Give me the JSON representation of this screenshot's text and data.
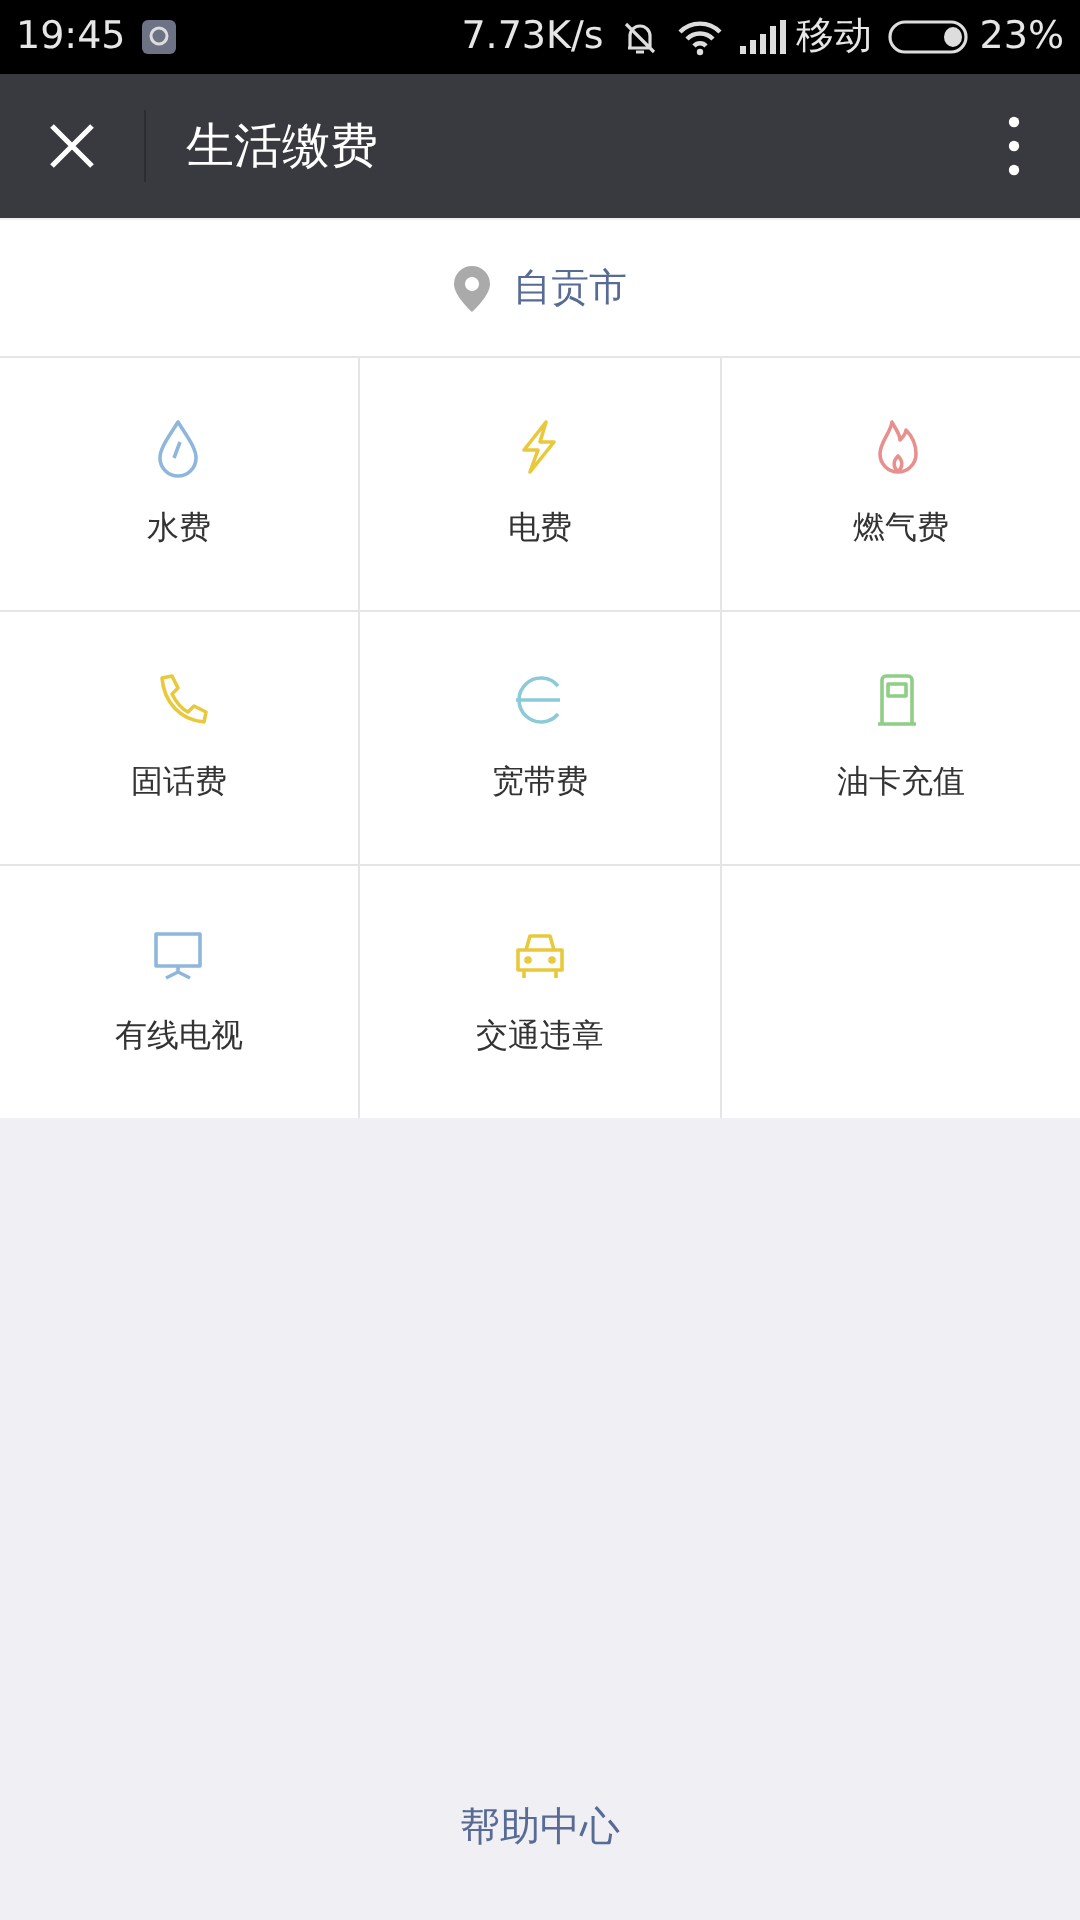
{
  "status_bar": {
    "time": "19:45",
    "speed": "7.73K/s",
    "carrier": "移动",
    "battery": "23%"
  },
  "title_bar": {
    "title": "生活缴费"
  },
  "location": {
    "city": "自贡市"
  },
  "services": [
    {
      "label": "水费",
      "kind": "water",
      "color": "#8fb7dc"
    },
    {
      "label": "电费",
      "kind": "power",
      "color": "#e9c93c"
    },
    {
      "label": "燃气费",
      "kind": "gas",
      "color": "#e8908e"
    },
    {
      "label": "固话费",
      "kind": "phone",
      "color": "#e9c93c"
    },
    {
      "label": "宽带费",
      "kind": "broadband",
      "color": "#8ccad8"
    },
    {
      "label": "油卡充值",
      "kind": "fuel",
      "color": "#8fce86"
    },
    {
      "label": "有线电视",
      "kind": "tv",
      "color": "#8fb7dc"
    },
    {
      "label": "交通违章",
      "kind": "traffic",
      "color": "#e9c93c"
    }
  ],
  "footer": {
    "link": "帮助中心"
  }
}
